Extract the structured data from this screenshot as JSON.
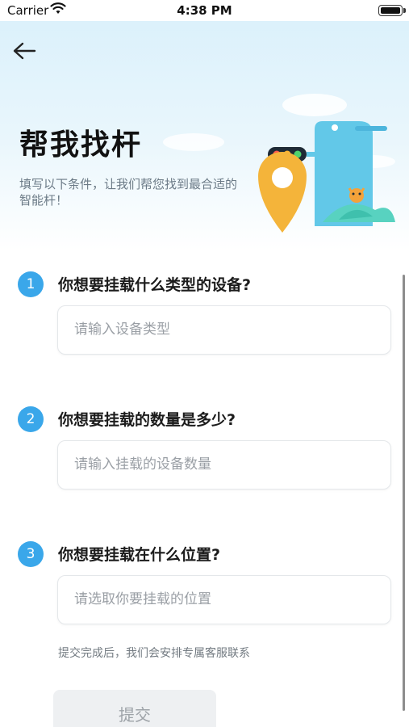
{
  "status_bar": {
    "carrier": "Carrier",
    "time": "4:38 PM"
  },
  "header": {
    "title": "帮我找杆",
    "subtitle": "填写以下条件，让我们帮您找到最合适的智能杆！"
  },
  "steps": [
    {
      "number": "1",
      "question": "你想要挂载什么类型的设备?",
      "placeholder": "请输入设备类型",
      "value": ""
    },
    {
      "number": "2",
      "question": "你想要挂载的数量是多少?",
      "placeholder": "请输入挂载的设备数量",
      "value": ""
    },
    {
      "number": "3",
      "question": "你想要挂载在什么位置?",
      "placeholder": "请选取你要挂载的位置",
      "value": ""
    }
  ],
  "note": "提交完成后，我们会安排专属客服联系",
  "submit_label": "提交",
  "colors": {
    "accent": "#3aa7ea",
    "header_bg": "#d9f0fb",
    "pin": "#f4b43a"
  },
  "icons": {
    "back": "arrow-left-icon",
    "wifi": "wifi-icon",
    "battery": "battery-icon"
  }
}
